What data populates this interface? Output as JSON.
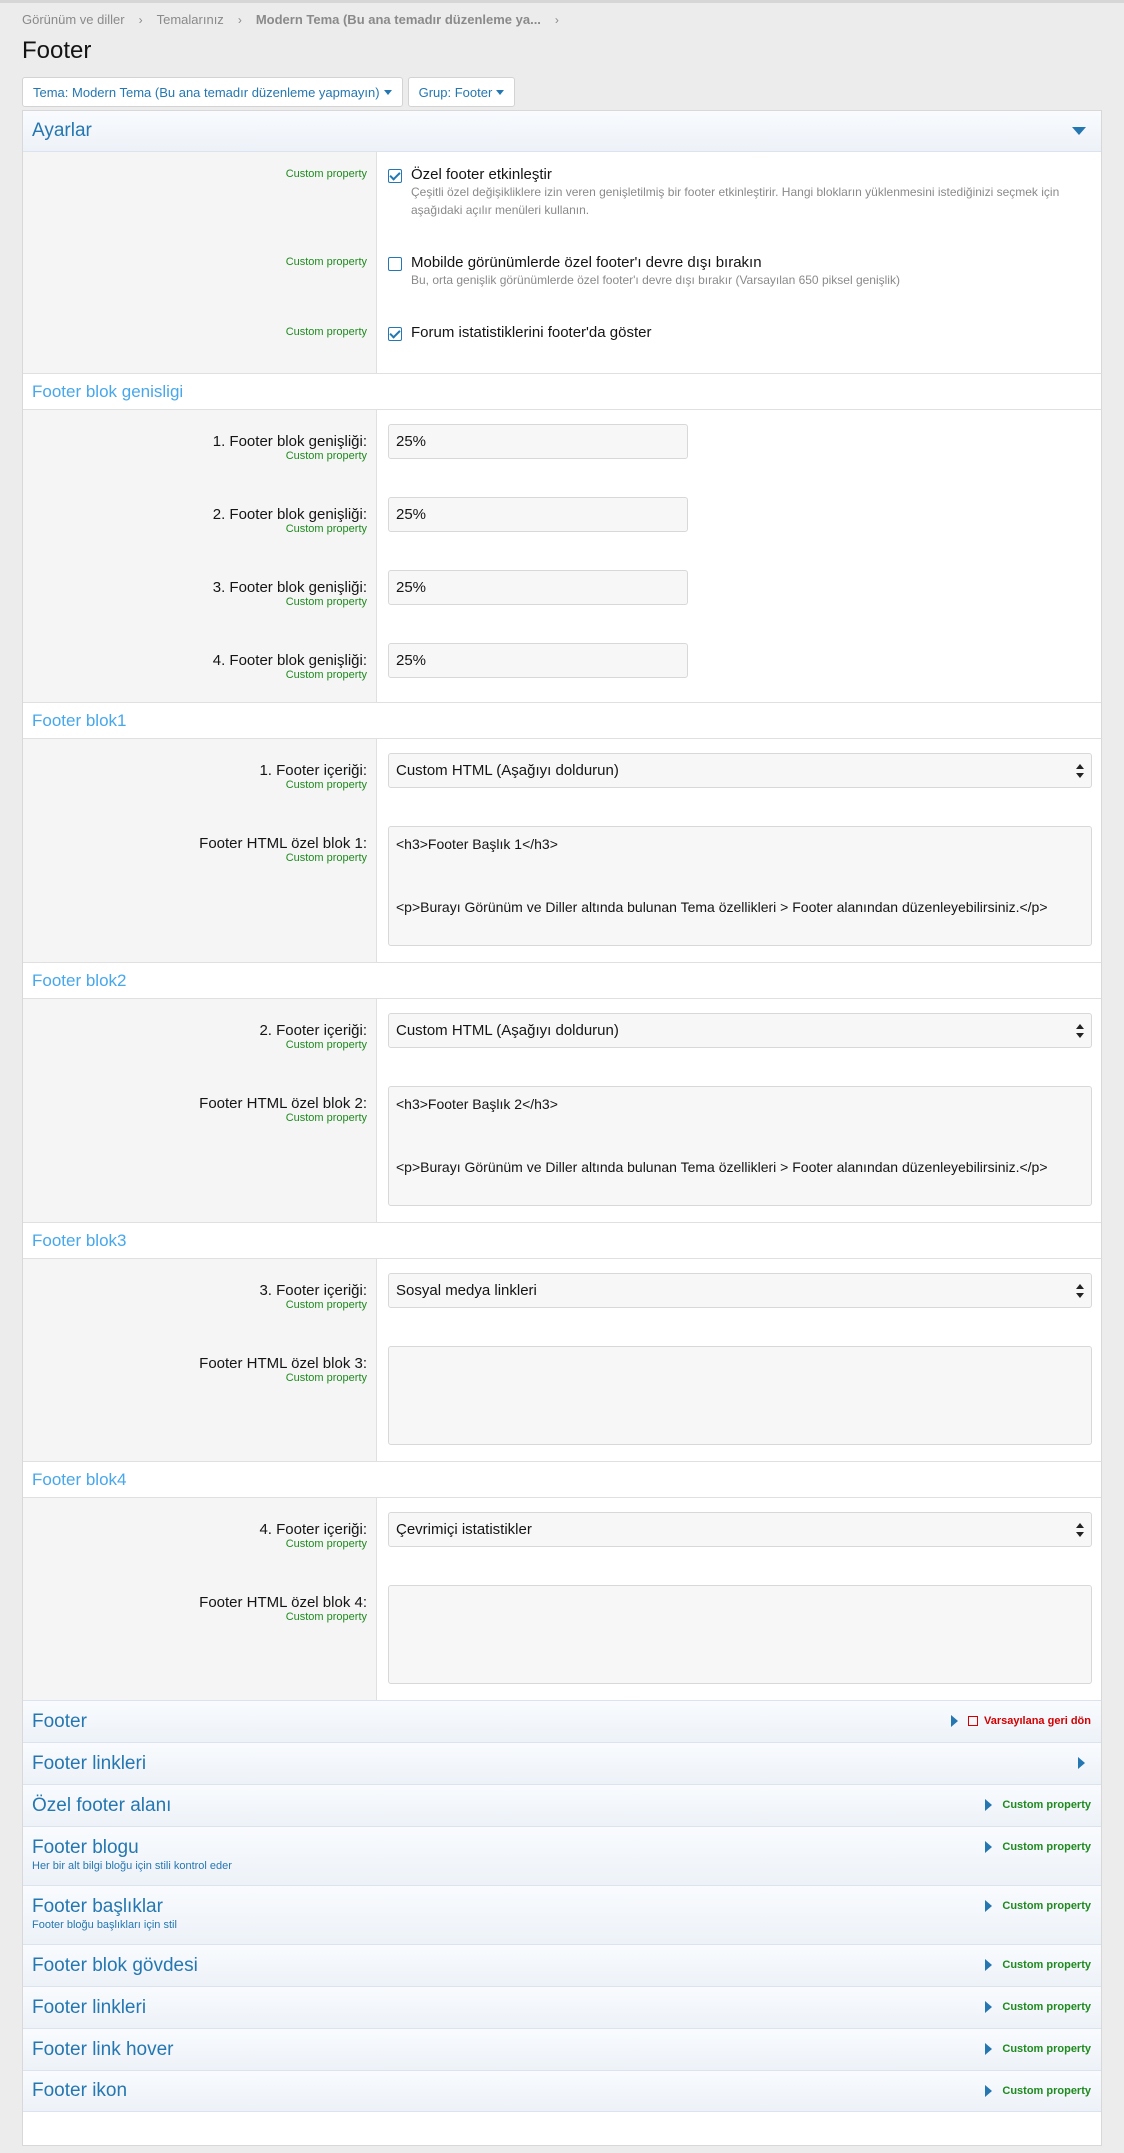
{
  "breadcrumb": [
    {
      "label": "Görünüm ve diller"
    },
    {
      "label": "Temalarınız"
    },
    {
      "label": "Modern Tema (Bu ana temadır düzenleme ya..."
    }
  ],
  "page_title": "Footer",
  "filters": {
    "theme": "Tema: Modern Tema (Bu ana temadır düzenleme yapmayın)",
    "group": "Grup: Footer"
  },
  "settings": {
    "title": "Ayarlar",
    "cp": "Custom property",
    "options": [
      {
        "title": "Özel footer etkinleştir",
        "hint": "Çeşitli özel değişikliklere izin veren genişletilmiş bir footer etkinleştirir. Hangi blokların yüklenmesini istediğinizi seçmek için aşağıdaki açılır menüleri kullanın.",
        "checked": true
      },
      {
        "title": "Mobilde görünümlerde özel footer'ı devre dışı bırakın",
        "hint": "Bu, orta genişlik görünümlerde özel footer'ı devre dışı bırakır (Varsayılan 650 piksel genişlik)",
        "checked": false
      },
      {
        "title": "Forum istatistiklerini footer'da göster",
        "hint": "",
        "checked": true
      }
    ]
  },
  "widths": {
    "title": "Footer blok genisligi",
    "rows": [
      {
        "label": "1. Footer blok genişliği:",
        "value": "25%"
      },
      {
        "label": "2. Footer blok genişliği:",
        "value": "25%"
      },
      {
        "label": "3. Footer blok genişliği:",
        "value": "25%"
      },
      {
        "label": "4. Footer blok genişliği:",
        "value": "25%"
      }
    ]
  },
  "blocks": [
    {
      "title": "Footer blok1",
      "content_label": "1. Footer içeriği:",
      "content_value": "Custom HTML (Aşağıyı doldurun)",
      "html_label": "Footer HTML özel blok 1:",
      "html_value": "<h3>Footer Başlık 1</h3>\n\n\n<p>Burayı Görünüm ve Diller altında bulunan Tema özellikleri > Footer alanından düzenleyebilirsiniz.</p>"
    },
    {
      "title": "Footer blok2",
      "content_label": "2. Footer içeriği:",
      "content_value": "Custom HTML (Aşağıyı doldurun)",
      "html_label": "Footer HTML özel blok 2:",
      "html_value": "<h3>Footer Başlık 2</h3>\n\n\n<p>Burayı Görünüm ve Diller altında bulunan Tema özellikleri > Footer alanından düzenleyebilirsiniz.</p>"
    },
    {
      "title": "Footer blok3",
      "content_label": "3. Footer içeriği:",
      "content_value": "Sosyal medya linkleri",
      "html_label": "Footer HTML özel blok 3:",
      "html_value": ""
    },
    {
      "title": "Footer blok4",
      "content_label": "4. Footer içeriği:",
      "content_value": "Çevrimiçi istatistikler",
      "html_label": "Footer HTML özel blok 4:",
      "html_value": ""
    }
  ],
  "collapsibles": [
    {
      "title": "Footer",
      "sub": "",
      "right": "Varsayılana geri dön",
      "kind": "revert"
    },
    {
      "title": "Footer linkleri",
      "sub": "",
      "right": "",
      "kind": "arrow"
    },
    {
      "title": "Özel footer alanı",
      "sub": "",
      "right": "Custom property",
      "kind": "cp"
    },
    {
      "title": "Footer blogu",
      "sub": "Her bir alt bilgi bloğu için stili kontrol eder",
      "right": "Custom property",
      "kind": "cp"
    },
    {
      "title": "Footer başlıklar",
      "sub": "Footer bloğu başlıkları için stil",
      "right": "Custom property",
      "kind": "cp"
    },
    {
      "title": "Footer blok gövdesi",
      "sub": "",
      "right": "Custom property",
      "kind": "cp"
    },
    {
      "title": "Footer linkleri",
      "sub": "",
      "right": "Custom property",
      "kind": "cp"
    },
    {
      "title": "Footer link hover",
      "sub": "",
      "right": "Custom property",
      "kind": "cp"
    },
    {
      "title": "Footer ikon",
      "sub": "",
      "right": "Custom property",
      "kind": "cp"
    }
  ]
}
